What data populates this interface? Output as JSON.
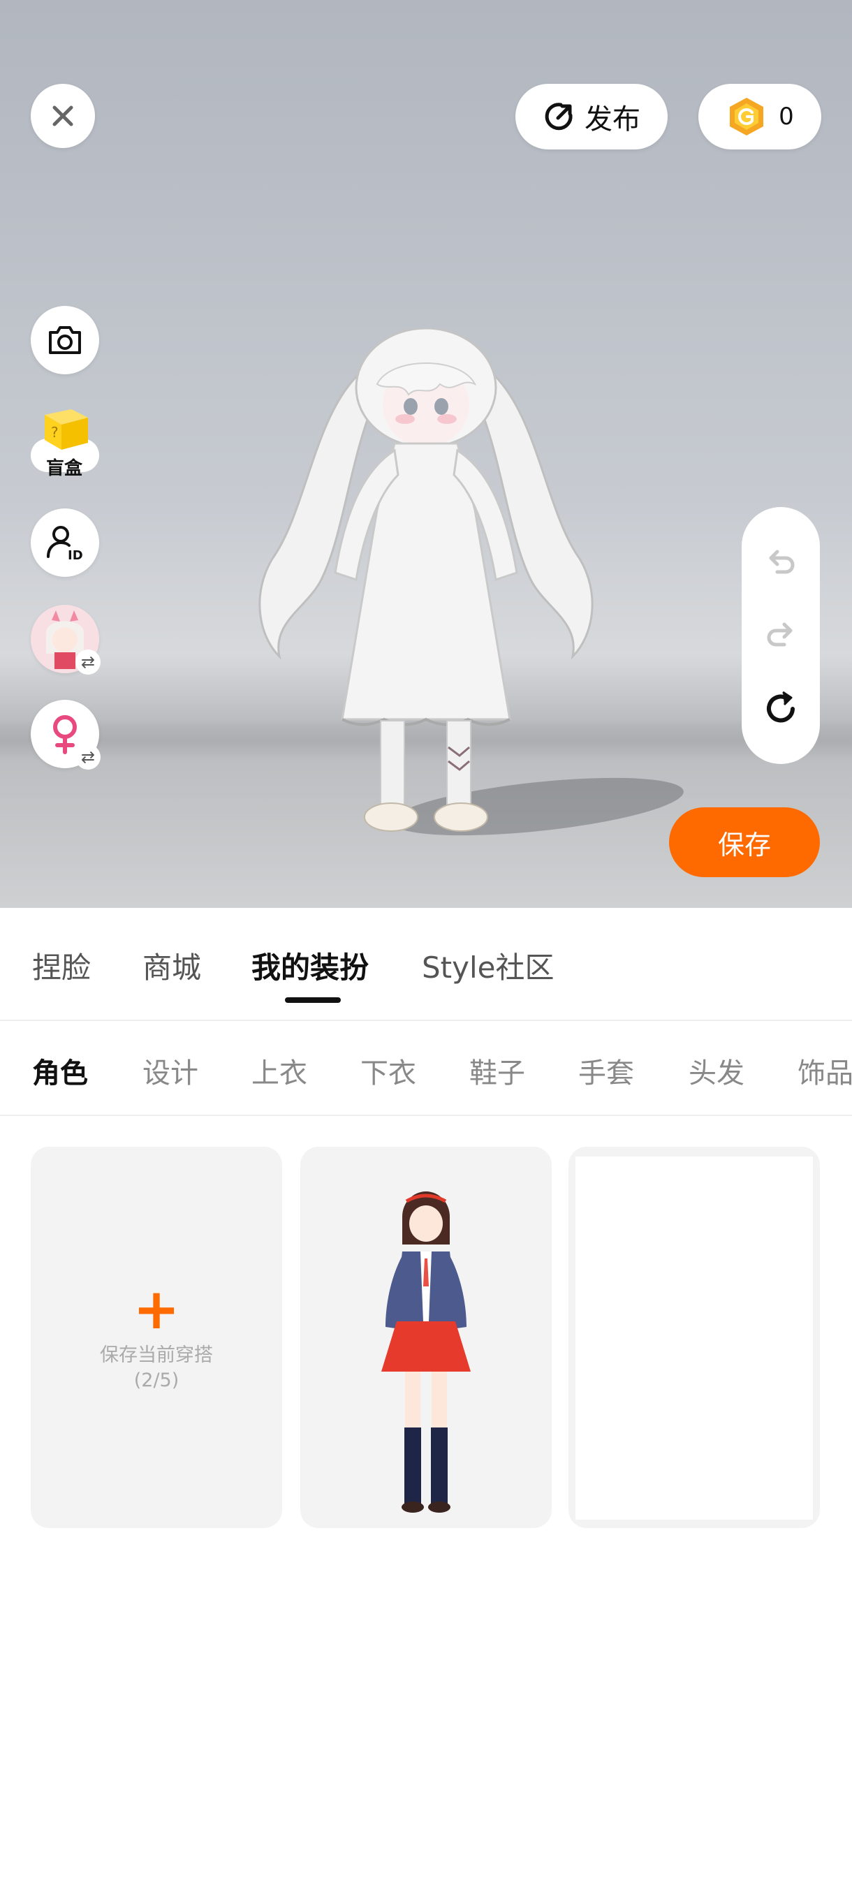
{
  "top_bar": {
    "close_icon": "close-icon",
    "publish_label": "发布",
    "publish_icon": "publish-arrow-icon",
    "coin_count": "0",
    "coin_icon": "g-coin-icon",
    "coin_color": "#f5a623"
  },
  "left_tools": {
    "camera_icon": "camera-icon",
    "blindbox_label": "盲盒",
    "id_icon": "user-id-icon",
    "swap_character_icon": "swap-icon",
    "gender_icon": "female-icon",
    "gender_color": "#e84a7f"
  },
  "history": {
    "undo_icon": "undo-icon",
    "redo_icon": "redo-icon",
    "reset_icon": "reset-icon"
  },
  "save_button_label": "保存",
  "accent_color": "#ff6a00",
  "main_tabs": [
    {
      "label": "捏脸",
      "active": false
    },
    {
      "label": "商城",
      "active": false
    },
    {
      "label": "我的装扮",
      "active": true
    },
    {
      "label": "Style社区",
      "active": false
    }
  ],
  "sub_tabs": [
    {
      "label": "角色",
      "active": true
    },
    {
      "label": "设计",
      "active": false
    },
    {
      "label": "上衣",
      "active": false
    },
    {
      "label": "下衣",
      "active": false
    },
    {
      "label": "鞋子",
      "active": false
    },
    {
      "label": "手套",
      "active": false
    },
    {
      "label": "头发",
      "active": false
    },
    {
      "label": "饰品",
      "active": false
    }
  ],
  "outfits": {
    "add_label": "保存当前穿搭",
    "add_count": "(2/5)"
  }
}
